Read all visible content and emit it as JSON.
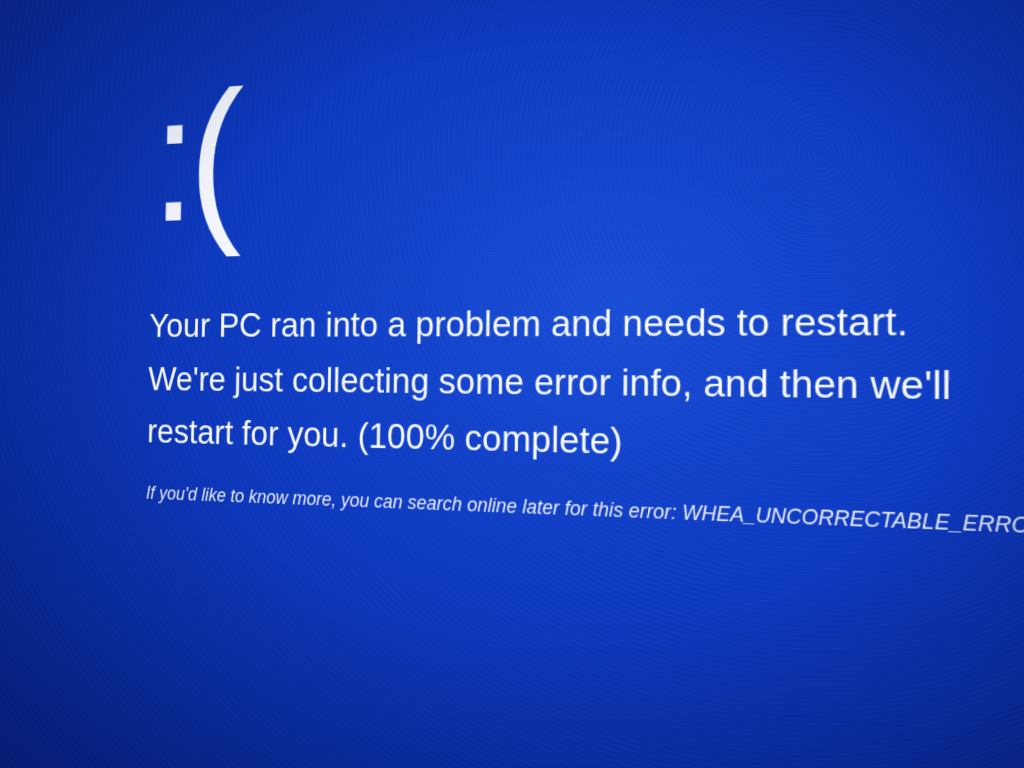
{
  "bsod": {
    "emoticon": ":(",
    "message": "Your PC ran into a problem and needs to restart. We're just collecting some error info, and then we'll restart for you. (100% complete)",
    "detail_prefix": "If you'd like to know more, you can search online later for this error: ",
    "error_code": "WHEA_UNCORRECTABLE_ERROR",
    "progress_percent": 100
  },
  "colors": {
    "background": "#0f3cc4",
    "text": "#ffffff"
  }
}
